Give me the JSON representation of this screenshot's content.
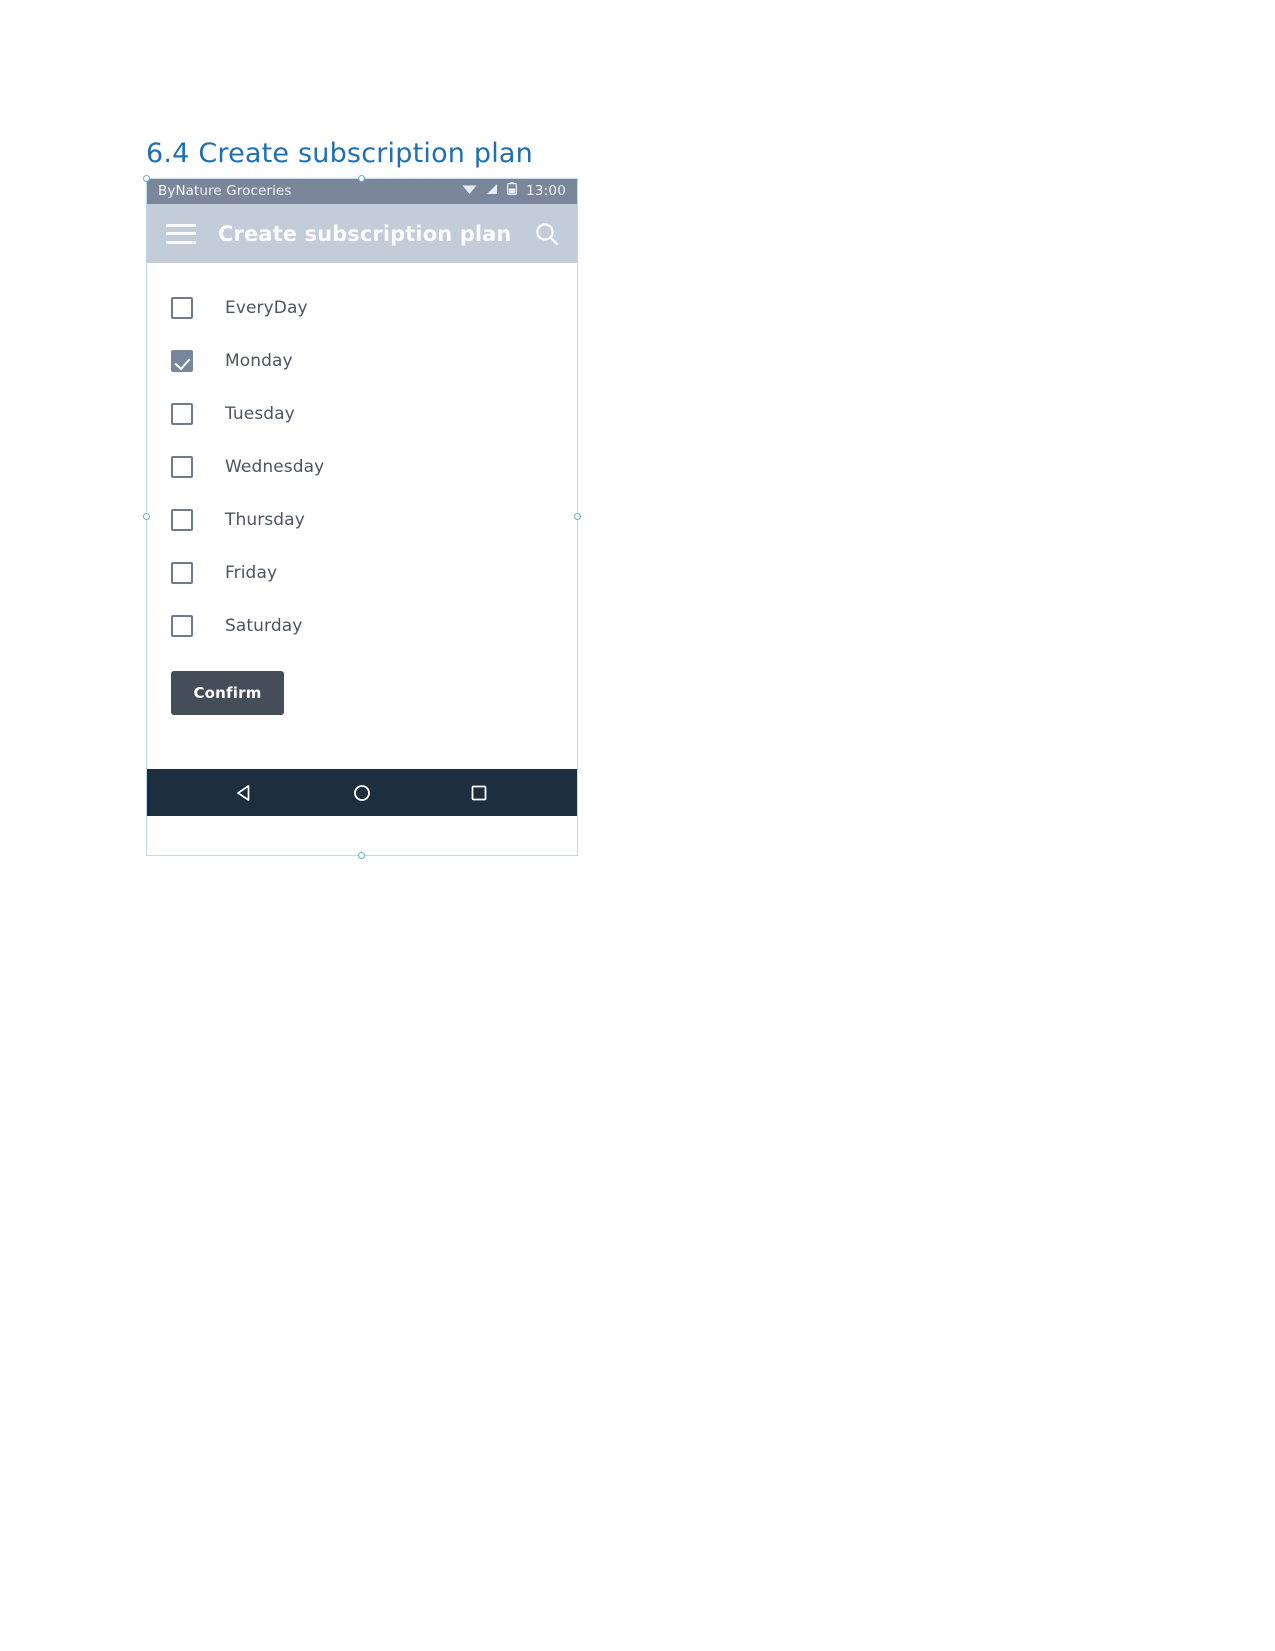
{
  "document": {
    "heading": "6.4 Create subscription plan"
  },
  "status_bar": {
    "app_name": "ByNature Groceries",
    "clock": "13:00",
    "icons": [
      "wifi-icon",
      "cell-signal-icon",
      "battery-icon"
    ]
  },
  "app_bar": {
    "menu_icon": "hamburger-menu-icon",
    "title": "Create subscription plan",
    "search_icon": "search-icon"
  },
  "content": {
    "days": [
      {
        "label": "EveryDay",
        "checked": false
      },
      {
        "label": "Monday",
        "checked": true
      },
      {
        "label": "Tuesday",
        "checked": false
      },
      {
        "label": "Wednesday",
        "checked": false
      },
      {
        "label": "Thursday",
        "checked": false
      },
      {
        "label": "Friday",
        "checked": false
      },
      {
        "label": "Saturday",
        "checked": false
      }
    ],
    "confirm_label": "Confirm"
  },
  "nav_bar": {
    "back_icon": "back-triangle-icon",
    "home_icon": "home-circle-icon",
    "recents_icon": "recents-square-icon"
  },
  "colors": {
    "heading": "#1F6FB2",
    "status_bar_bg": "#7A879B",
    "app_bar_bg": "#C3CCD9",
    "nav_bar_bg": "#1D2E3E",
    "confirm_bg": "#454D59",
    "checkbox_checked": "#78859B",
    "checkbox_border": "#6F7B8B",
    "day_label": "#4B5563"
  }
}
